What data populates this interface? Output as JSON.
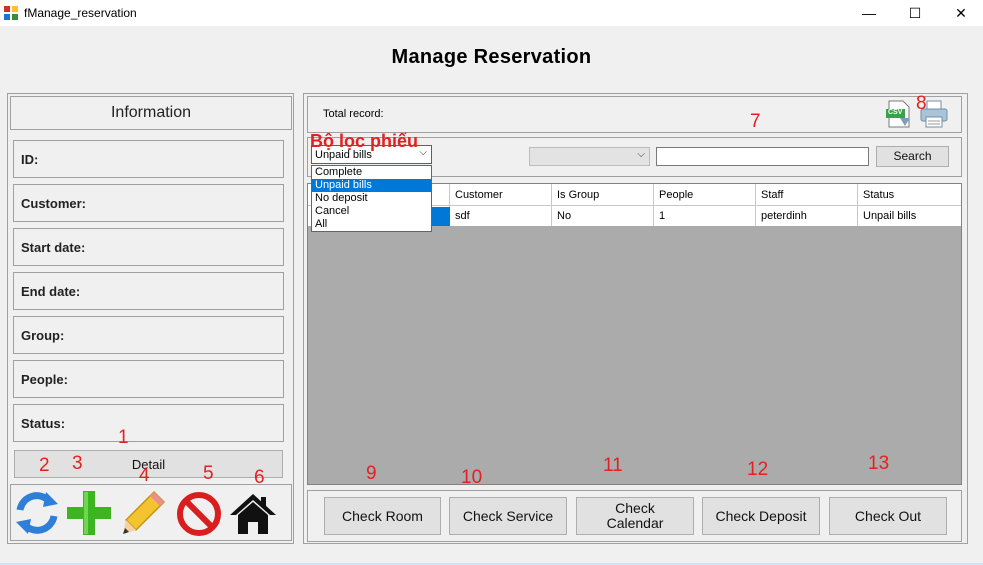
{
  "window": {
    "title": "fManage_reservation",
    "minimize_glyph": "—",
    "maximize_glyph": "☐",
    "close_glyph": "✕"
  },
  "page": {
    "title": "Manage Reservation"
  },
  "info_panel": {
    "header": "Information",
    "fields": [
      {
        "label": "ID:"
      },
      {
        "label": "Customer:"
      },
      {
        "label": "Start date:"
      },
      {
        "label": "End date:"
      },
      {
        "label": "Group:"
      },
      {
        "label": "People:"
      },
      {
        "label": "Status:"
      }
    ],
    "detail_button": "Detail",
    "toolbar_icons": [
      "refresh-icon",
      "add-icon",
      "edit-pencil-icon",
      "cancel-icon",
      "home-icon"
    ]
  },
  "records_panel": {
    "total_label": "Total record:",
    "export_icons": [
      "csv-export-icon",
      "print-icon"
    ],
    "csv_text": "CSV"
  },
  "filter": {
    "selected": "Unpaid bills",
    "options": [
      "Complete",
      "Unpaid bills",
      "No deposit",
      "Cancel",
      "All"
    ],
    "search_placeholder": "",
    "search_button": "Search"
  },
  "table": {
    "columns": [
      "",
      "Customer",
      "Is Group",
      "People",
      "Staff",
      "Status"
    ],
    "rows": [
      {
        "id": "",
        "customer": "sdf",
        "is_group": "No",
        "people": "1",
        "staff": "peterdinh",
        "status": "Unpail bills"
      }
    ]
  },
  "actions": {
    "check_room": "Check Room",
    "check_service": "Check Service",
    "check_calendar_line1": "Check",
    "check_calendar_line2": "Calendar",
    "check_deposit": "Check Deposit",
    "check_out": "Check Out"
  },
  "annotations": {
    "n1": "1",
    "n2": "2",
    "n3": "3",
    "n4": "4",
    "n5": "5",
    "n6": "6",
    "n7": "7",
    "n8": "8",
    "n9": "9",
    "n10": "10",
    "n11": "11",
    "n12": "12",
    "n13": "13",
    "filter_caption": "Bộ lọc phiếu"
  },
  "colors": {
    "accent_selection": "#0078d7",
    "annotation_red": "#e52020",
    "grid_background": "#ababab"
  }
}
